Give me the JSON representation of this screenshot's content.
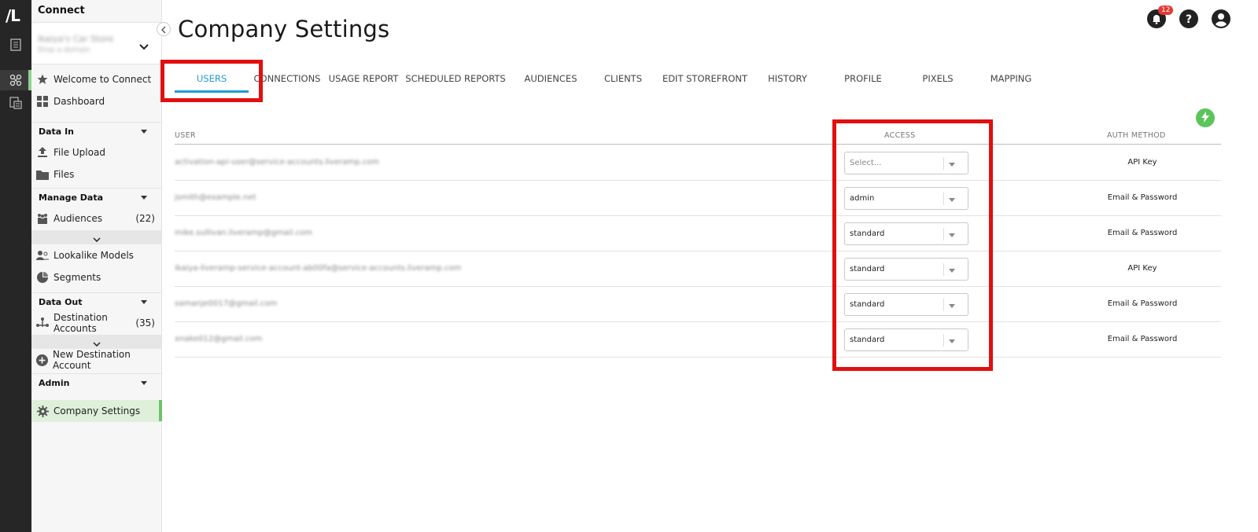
{
  "rail": {
    "logo": "/L"
  },
  "sidebar": {
    "title": "Connect",
    "org": {
      "name": "Ikaiya's Car Store",
      "link": "Drop a domain"
    },
    "items_top": [
      {
        "label": "Welcome to Connect",
        "icon": "star-icon"
      },
      {
        "label": "Dashboard",
        "icon": "dashboard-icon"
      }
    ],
    "sections": {
      "data_in": "Data In",
      "manage_data": "Manage Data",
      "data_out": "Data Out",
      "admin": "Admin"
    },
    "data_in_items": [
      {
        "label": "File Upload",
        "icon": "upload-icon"
      },
      {
        "label": "Files",
        "icon": "folder-icon"
      }
    ],
    "manage_items": [
      {
        "label": "Audiences",
        "count": "(22)",
        "icon": "people-icon"
      },
      {
        "label": "Lookalike Models",
        "icon": "lookalike-icon"
      },
      {
        "label": "Segments",
        "icon": "pie-icon"
      }
    ],
    "out_items": [
      {
        "label": "Destination Accounts",
        "count": "(35)",
        "icon": "share-icon"
      },
      {
        "label": "New Destination Account",
        "icon": "plus-circle-icon"
      }
    ],
    "admin_items": [
      {
        "label": "Company Settings",
        "icon": "gear-icon"
      }
    ]
  },
  "header": {
    "title": "Company Settings",
    "notifications_count": "12"
  },
  "tabs": [
    {
      "label": "USERS",
      "active": true
    },
    {
      "label": "CONNECTIONS"
    },
    {
      "label": "USAGE REPORT"
    },
    {
      "label": "SCHEDULED REPORTS"
    },
    {
      "label": "AUDIENCES"
    },
    {
      "label": "CLIENTS"
    },
    {
      "label": "EDIT STOREFRONT"
    },
    {
      "label": "HISTORY"
    },
    {
      "label": "PROFILE"
    },
    {
      "label": "PIXELS"
    },
    {
      "label": "MAPPING"
    }
  ],
  "table": {
    "headers": {
      "user": "USER",
      "access": "ACCESS",
      "auth": "AUTH METHOD"
    },
    "rows": [
      {
        "email": "activation-api-user@service-accounts.liveramp.com",
        "access": "Select...",
        "placeholder": true,
        "auth": "API Key"
      },
      {
        "email": "jsmith@example.net",
        "access": "admin",
        "auth": "Email & Password"
      },
      {
        "email": "mike.sullivan.liveramp@gmail.com",
        "access": "standard",
        "auth": "Email & Password"
      },
      {
        "email": "ikaiya-liveramp-service-account-ab00fa@service-accounts.liveramp.com",
        "access": "standard",
        "auth": "API Key"
      },
      {
        "email": "samanje0017@gmail.com",
        "access": "standard",
        "auth": "Email & Password"
      },
      {
        "email": "xnake012@gmail.com",
        "access": "standard",
        "auth": "Email & Password"
      }
    ]
  },
  "colors": {
    "accent": "#1e9cd7",
    "highlight": "#e01010",
    "active_bg": "#dff0da",
    "success": "#5cc45c"
  }
}
